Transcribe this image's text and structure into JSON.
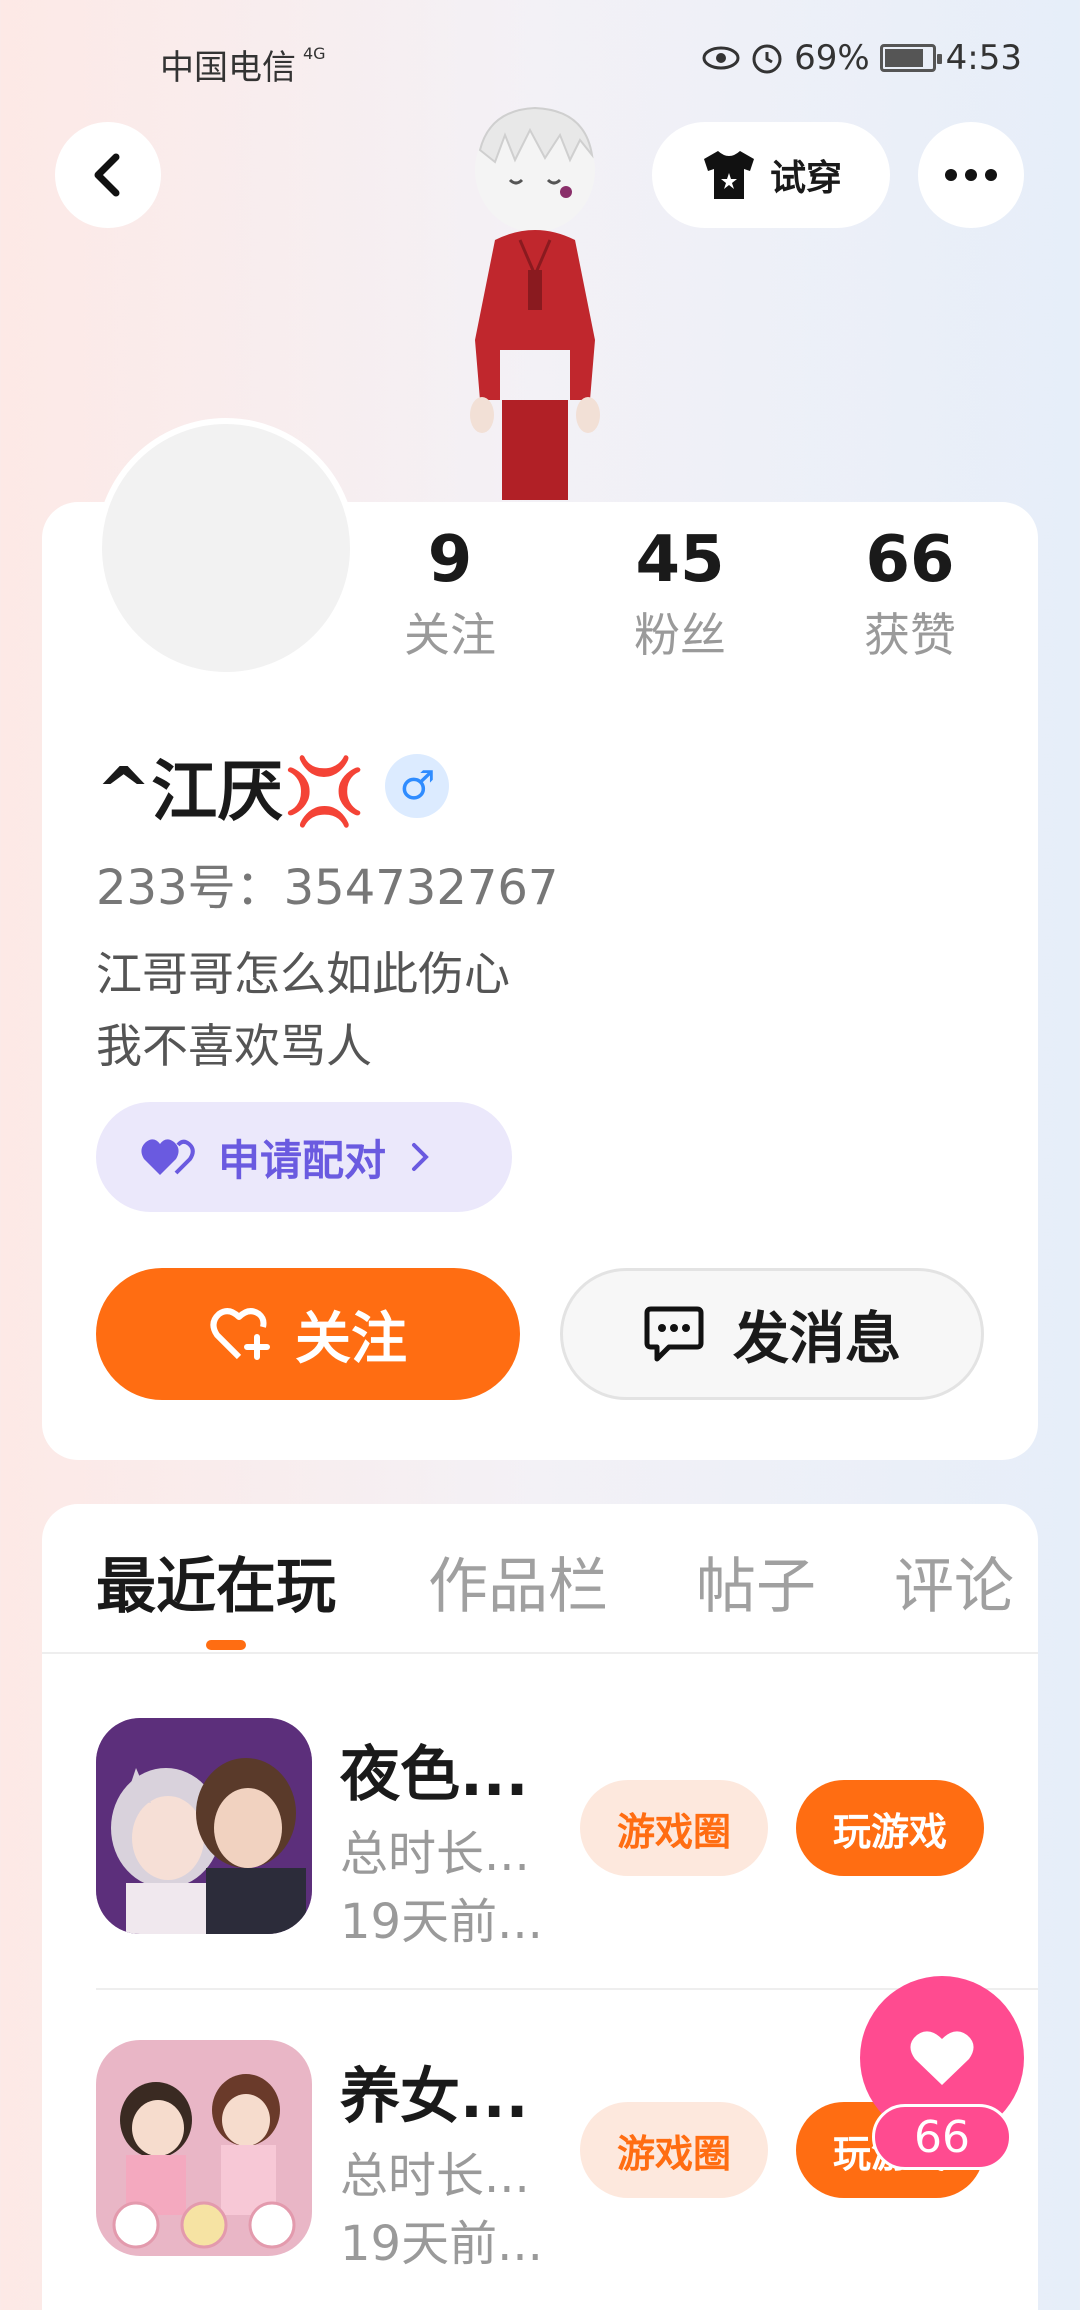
{
  "status_bar": {
    "carrier": "中国电信",
    "network": "4G",
    "battery": "69%",
    "time": "4:53"
  },
  "header": {
    "tryon_label": "试穿"
  },
  "profile": {
    "stats": [
      {
        "value": "9",
        "label": "关注"
      },
      {
        "value": "45",
        "label": "粉丝"
      },
      {
        "value": "66",
        "label": "获赞"
      }
    ],
    "username": "^江厌💢",
    "gender_symbol": "♂",
    "id_line": "233号：354732767",
    "bio_lines": [
      "江哥哥怎么如此伤心",
      "我不喜欢骂人"
    ],
    "match_label": "申请配对",
    "follow_label": "关注",
    "message_label": "发消息"
  },
  "tabs": [
    {
      "label": "最近在玩",
      "active": true
    },
    {
      "label": "作品栏",
      "active": false
    },
    {
      "label": "帖子",
      "active": false
    },
    {
      "label": "评论",
      "active": false
    }
  ],
  "games": [
    {
      "title": "夜色...",
      "total_time": "总时长...",
      "last_played": "19天前...",
      "circle_label": "游戏圈",
      "play_label": "玩游戏"
    },
    {
      "title": "养女...",
      "total_time": "总时长...",
      "last_played": "19天前...",
      "circle_label": "游戏圈",
      "play_label": "玩游戏"
    }
  ],
  "like_fab": {
    "count": "66"
  },
  "colors": {
    "accent": "#ff6d12",
    "match_purple": "#6a5ae0",
    "like_pink": "#ff4b90"
  }
}
